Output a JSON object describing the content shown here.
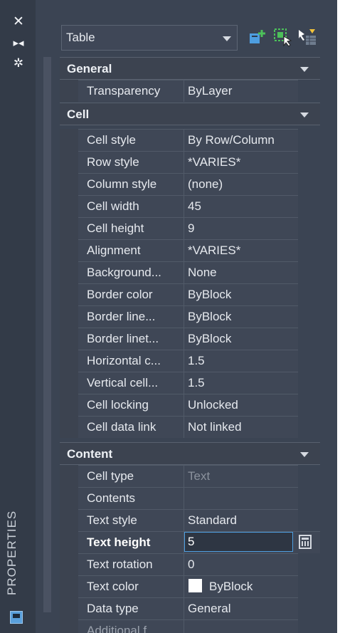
{
  "palette": {
    "window_bg": "#3b4453",
    "row_bg": "#3f4756",
    "accent_edit": "#4e9ee0",
    "text": "#e6e9ee",
    "muted_text": "#8b929d"
  },
  "left_strip": {
    "close_icon": "close-icon",
    "pin_icon": "auto-hide-icon",
    "settings_icon": "settings-icon",
    "vertical_label": "PROPERTIES",
    "palette_icon": "properties-palette-icon"
  },
  "header": {
    "object_type": "Table",
    "toolbar_icons": [
      "toggle-pickadd-icon",
      "select-objects-icon",
      "quick-select-icon"
    ]
  },
  "sections": {
    "general": {
      "title": "General",
      "rows": [
        {
          "name": "Transparency",
          "value": "ByLayer"
        }
      ]
    },
    "cell": {
      "title": "Cell",
      "rows": [
        {
          "name": "Cell style",
          "value": "By Row/Column"
        },
        {
          "name": "Row style",
          "value": "*VARIES*"
        },
        {
          "name": "Column style",
          "value": "(none)"
        },
        {
          "name": "Cell width",
          "value": "45"
        },
        {
          "name": "Cell height",
          "value": "9"
        },
        {
          "name": "Alignment",
          "value": "*VARIES*"
        },
        {
          "name": "Background...",
          "value": " None"
        },
        {
          "name": "Border color",
          "value": "ByBlock"
        },
        {
          "name": "Border line...",
          "value": "ByBlock"
        },
        {
          "name": "Border linet...",
          "value": "ByBlock"
        },
        {
          "name": "Horizontal c...",
          "value": "1.5"
        },
        {
          "name": "Vertical cell...",
          "value": "1.5"
        },
        {
          "name": "Cell locking",
          "value": "Unlocked"
        },
        {
          "name": "Cell data link",
          "value": "Not linked"
        }
      ]
    },
    "content": {
      "title": "Content",
      "rows": [
        {
          "name": "Cell type",
          "value": "Text"
        },
        {
          "name": "Contents",
          "value": ""
        },
        {
          "name": "Text style",
          "value": "Standard"
        },
        {
          "name": "Text height",
          "value": "5"
        },
        {
          "name": "Text rotation",
          "value": "0"
        },
        {
          "name": "Text color",
          "value": "ByBlock"
        },
        {
          "name": "Data type",
          "value": "General"
        },
        {
          "name": "Additional f...",
          "value": ""
        }
      ]
    }
  }
}
